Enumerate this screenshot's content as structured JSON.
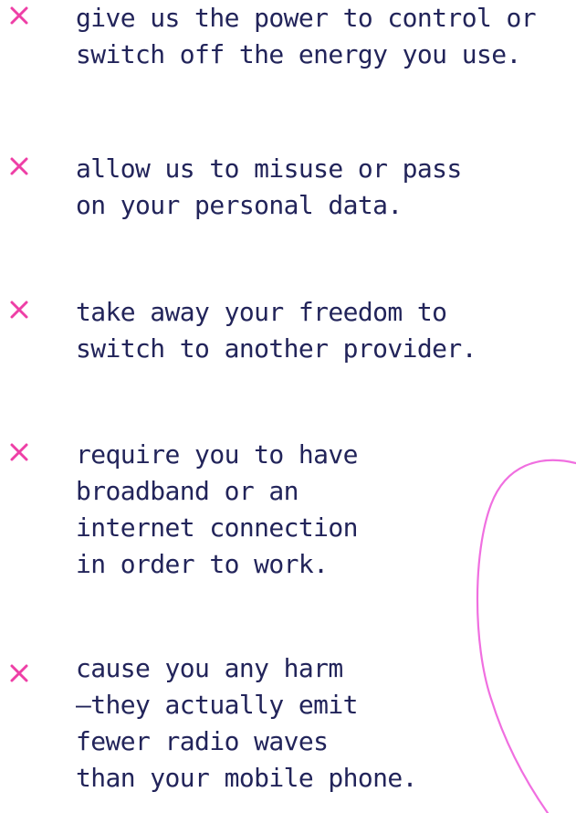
{
  "colors": {
    "text": "#22245a",
    "accent": "#ee3fa6",
    "curve": "#f06fe0",
    "background": "#ffffff"
  },
  "icons": {
    "bullet": "cross-icon"
  },
  "items": [
    {
      "text": "give us the power to control or\nswitch off the energy you use."
    },
    {
      "text": "allow us to misuse or pass\non your personal data."
    },
    {
      "text": "take away your freedom to\nswitch to another provider."
    },
    {
      "text": "require you to have\nbroadband or an\ninternet connection\nin order to work."
    },
    {
      "text": "cause you any harm\n–they actually emit\nfewer radio waves\nthan your mobile phone."
    }
  ]
}
